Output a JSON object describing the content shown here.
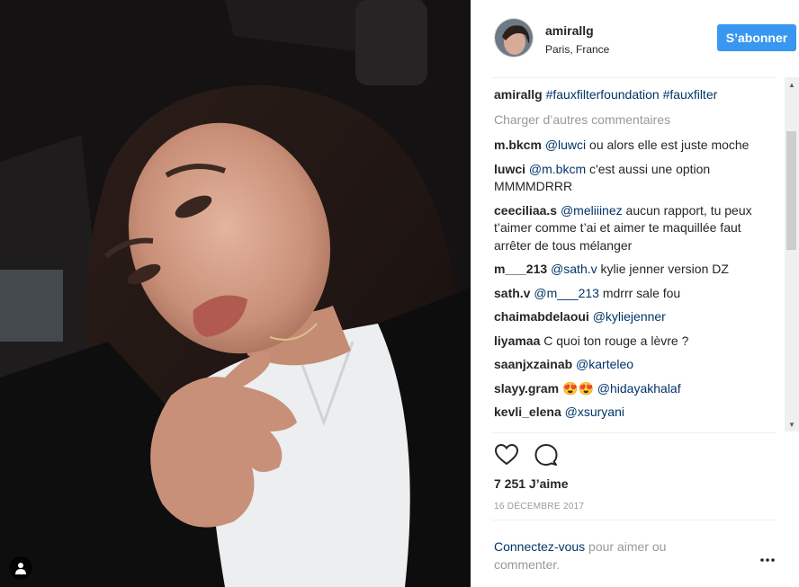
{
  "photo": {
    "alt": "selfie photo"
  },
  "header": {
    "username": "amirallg",
    "location": "Paris, France",
    "follow_label": "S’abonner"
  },
  "caption": {
    "user": "amirallg",
    "tags": [
      "#fauxfilterfoundation",
      "#fauxfilter"
    ]
  },
  "load_more_label": "Charger d’autres commentaires",
  "comments": [
    {
      "user": "m.bkcm",
      "mention": "@luwci",
      "text": " ou alors elle est juste moche"
    },
    {
      "user": "luwci",
      "mention": "@m.bkcm",
      "text": " c'est aussi une option MMMMDRRR"
    },
    {
      "user": "ceeciliaa.s",
      "mention": "@meliiinez",
      "text": " aucun rapport, tu peux t’aimer comme t’ai et aimer te maquillée faut arrêter de tous mélanger"
    },
    {
      "user": "m___213",
      "mention": "@sath.v",
      "text": " kylie jenner version DZ"
    },
    {
      "user": "sath.v",
      "mention": "@m___213",
      "text": " mdrrr sale fou"
    },
    {
      "user": "chaimabdelaoui",
      "mention": "@kyliejenner",
      "text": ""
    },
    {
      "user": "liyamaa",
      "mention": "",
      "text": "C quoi ton rouge a lèvre ?"
    },
    {
      "user": "saanjxzainab",
      "mention": "@karteleo",
      "text": ""
    },
    {
      "user": "slayy.gram",
      "mention": "@hidayakhalaf",
      "text": "😍😍 "
    },
    {
      "user": "kevli_elena",
      "mention": "@xsuryani",
      "text": ""
    }
  ],
  "likes_label": "7 251 J’aime",
  "date_label": "16 DÉCEMBRE 2017",
  "login": {
    "link_label": "Connectez-vous",
    "text": " pour aimer ou commenter."
  },
  "icons": {
    "like": "heart-icon",
    "comment": "comment-icon",
    "more": "more-options-icon",
    "user_tag": "user-tag-icon"
  },
  "colors": {
    "accent": "#3897f0",
    "link": "#003569",
    "muted": "#999999"
  }
}
